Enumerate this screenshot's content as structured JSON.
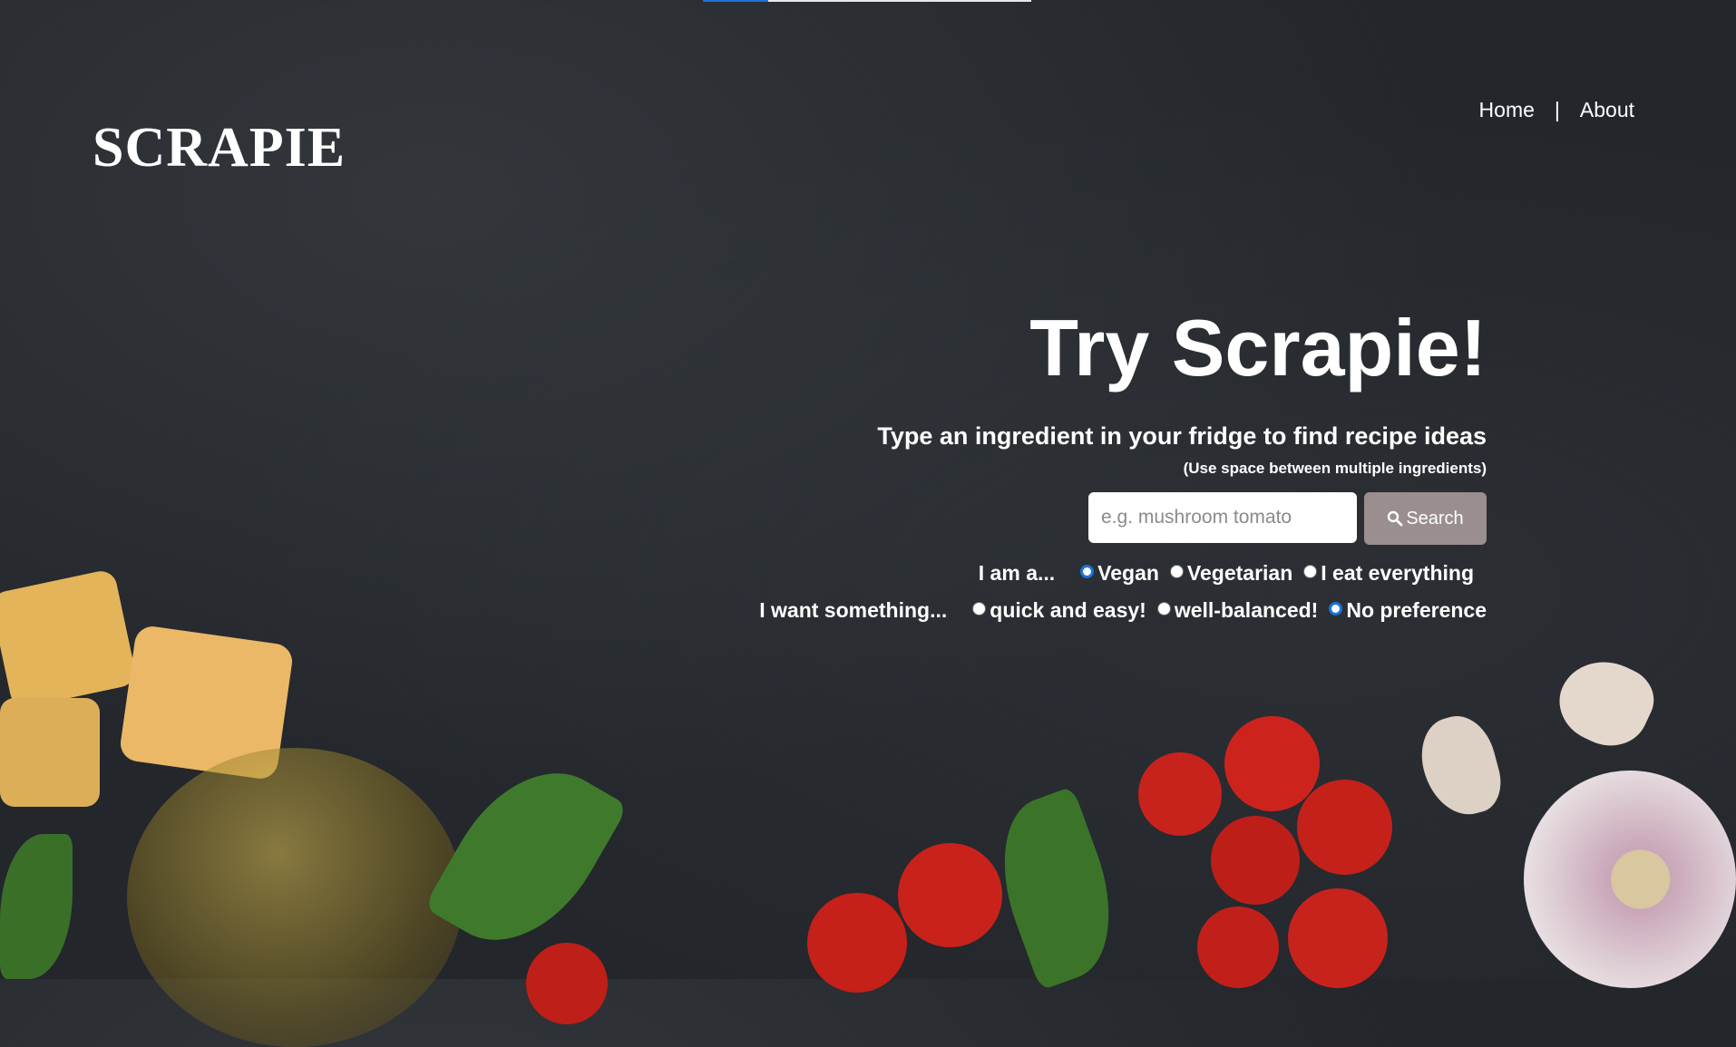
{
  "header": {
    "logo": "SCRAPIE"
  },
  "nav": {
    "home": "Home",
    "separator": "|",
    "about": "About"
  },
  "loader": {
    "progress": 0.2
  },
  "hero": {
    "title": "Try Scrapie!",
    "subtitle": "Type an ingredient in your fridge to find recipe ideas",
    "hint": "(Use space between multiple ingredients)"
  },
  "search": {
    "placeholder": "e.g. mushroom tomato",
    "button_label": "Search",
    "value": ""
  },
  "diet": {
    "label": "I am a...",
    "options": [
      "Vegan",
      "Vegetarian",
      "I eat everything"
    ],
    "selected": "Vegan"
  },
  "effort": {
    "label": "I want something...",
    "options": [
      "quick and easy!",
      "well-balanced!",
      "No preference"
    ],
    "selected": "No preference"
  },
  "colors": {
    "accent": "#1a73d9",
    "search_button": "#9a8e8e",
    "background": "#23262b"
  }
}
